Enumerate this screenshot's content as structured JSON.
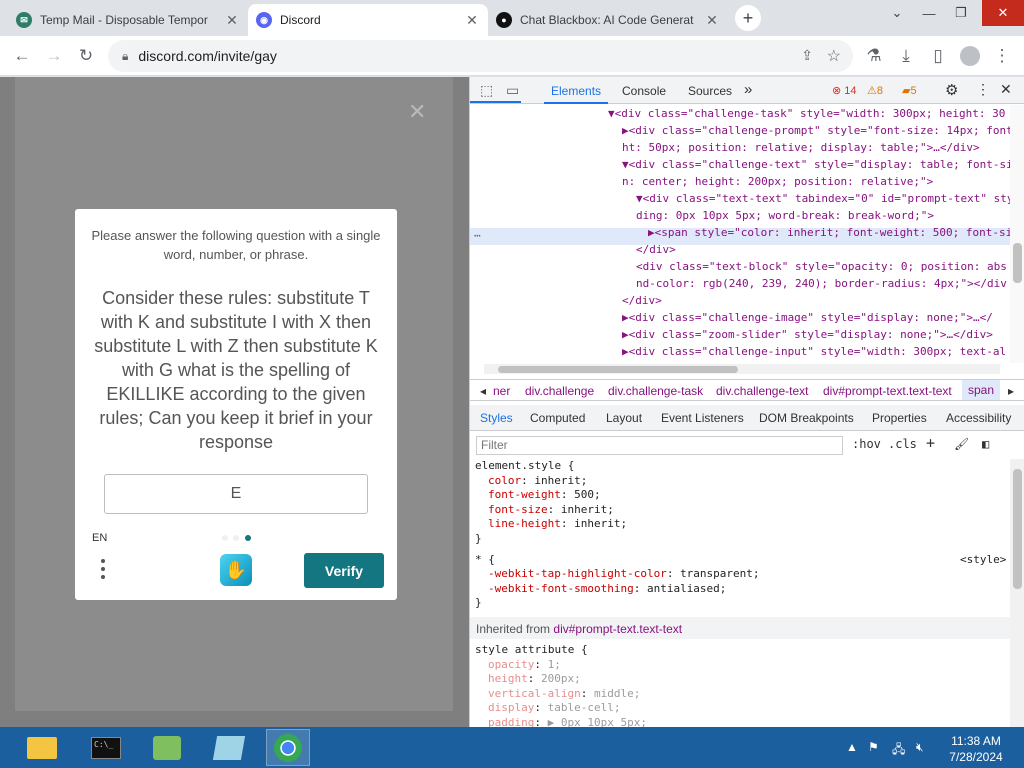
{
  "browser": {
    "tabs": [
      {
        "title": "Temp Mail - Disposable Tempor",
        "icon": "temp-mail-icon",
        "color": "#2e7d6b"
      },
      {
        "title": "Discord",
        "icon": "discord-icon",
        "color": "#5865f2"
      },
      {
        "title": "Chat Blackbox: AI Code Generat",
        "icon": "blackbox-icon",
        "color": "#111111"
      }
    ],
    "url": "discord.com/invite/gay"
  },
  "captcha": {
    "instruction": "Please answer the following question with a single word, number, or phrase.",
    "question": "Consider these rules: substitute T with K and substitute I with X then substitute L with Z then substitute K with G what is the spelling of EKILLIKE according to the given rules; Can you keep it brief in your response",
    "answer": "E",
    "language": "EN",
    "verify_label": "Verify",
    "accent": "#137681"
  },
  "devtools": {
    "tabs": [
      "Elements",
      "Console",
      "Sources"
    ],
    "errors": "14",
    "warnings": "8",
    "issues": "5",
    "dom_lines": [
      {
        "indent": 0,
        "text": "▼<div class=\"challenge-task\" style=\"width: 300px; height: 30"
      },
      {
        "indent": 1,
        "text": "▶<div class=\"challenge-prompt\" style=\"font-size: 14px; font"
      },
      {
        "indent": 1,
        "text": "ht: 50px; position: relative; display: table;\">…</div>"
      },
      {
        "indent": 1,
        "text": "▼<div class=\"challenge-text\" style=\"display: table; font-si"
      },
      {
        "indent": 1,
        "text": "n: center; height: 200px; position: relative;\">"
      },
      {
        "indent": 2,
        "text": "▼<div class=\"text-text\" tabindex=\"0\" id=\"prompt-text\" sty"
      },
      {
        "indent": 2,
        "text": "ding: 0px 10px 5px; word-break: break-word;\">"
      },
      {
        "indent": 3,
        "text": "▶<span style=\"color: inherit; font-weight: 500; font-si"
      },
      {
        "indent": 2,
        "text": "</div>"
      },
      {
        "indent": 2,
        "text": "<div class=\"text-block\" style=\"opacity: 0; position: abs"
      },
      {
        "indent": 2,
        "text": "nd-color: rgb(240, 239, 240); border-radius: 4px;\"></div"
      },
      {
        "indent": 1,
        "text": "</div>"
      },
      {
        "indent": 1,
        "text": "▶<div class=\"challenge-image\" style=\"display: none;\">…</"
      },
      {
        "indent": 1,
        "text": "▶<div class=\"zoom-slider\" style=\"display: none;\">…</div>"
      },
      {
        "indent": 1,
        "text": "▶<div class=\"challenge-input\" style=\"width: 300px; text-al"
      }
    ],
    "breadcrumbs": [
      "ner",
      "div.challenge",
      "div.challenge-task",
      "div.challenge-text",
      "div#prompt-text.text-text",
      "span"
    ],
    "style_tabs": [
      "Styles",
      "Computed",
      "Layout",
      "Event Listeners",
      "DOM Breakpoints",
      "Properties",
      "Accessibility"
    ],
    "filter_placeholder": "Filter",
    "hov": ":hov",
    "cls": ".cls",
    "element_style_selector": "element.style {",
    "element_style": [
      {
        "prop": "color",
        "val": "inherit;"
      },
      {
        "prop": "font-weight",
        "val": "500;"
      },
      {
        "prop": "font-size",
        "val": "inherit;"
      },
      {
        "prop": "line-height",
        "val": "inherit;"
      }
    ],
    "star_selector": "* {",
    "star_source": "<style>",
    "star_rules": [
      {
        "prop": "-webkit-tap-highlight-color",
        "val": "transparent;"
      },
      {
        "prop": "-webkit-font-smoothing",
        "val": "antialiased;"
      }
    ],
    "close_brace": "}",
    "inherited_label": "Inherited from",
    "inherited_from": "div#prompt-text.text-text",
    "style_attr_selector": "style attribute {",
    "style_attr": [
      {
        "prop": "opacity",
        "val": "1;"
      },
      {
        "prop": "height",
        "val": "200px;"
      },
      {
        "prop": "vertical-align",
        "val": "middle;"
      },
      {
        "prop": "display",
        "val": "table-cell;"
      },
      {
        "prop": "padding",
        "val": "▶ 0px 10px 5px;"
      }
    ]
  },
  "taskbar": {
    "time": "11:38 AM",
    "date": "7/28/2024"
  }
}
